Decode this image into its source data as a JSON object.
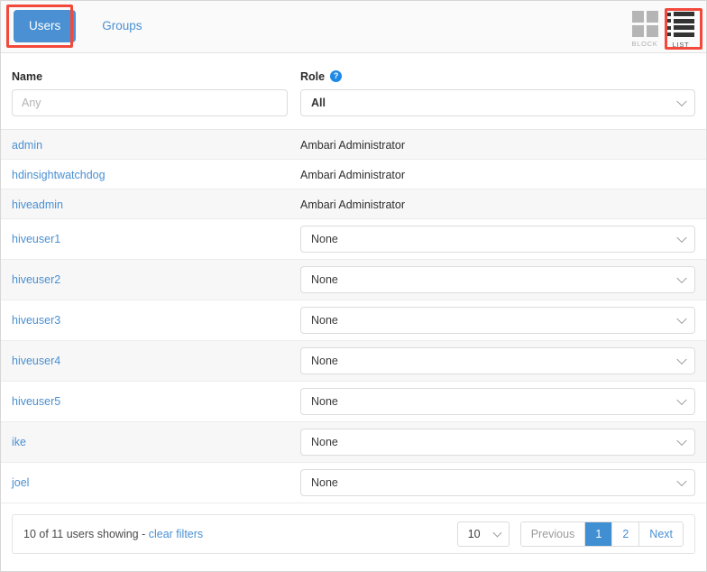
{
  "tabs": [
    {
      "label": "Users",
      "active": true
    },
    {
      "label": "Groups",
      "active": false
    }
  ],
  "view_toggle": {
    "block_label": "BLOCK",
    "list_label": "LIST",
    "selected": "LIST",
    "block_icon": "grid-icon",
    "list_icon": "list-icon"
  },
  "filters": {
    "name_label": "Name",
    "name_placeholder": "Any",
    "name_value": "",
    "role_label": "Role",
    "role_help_icon": "help-circle-icon",
    "role_value": "All"
  },
  "table": {
    "columns": [
      "Name",
      "Role"
    ],
    "rows": [
      {
        "name": "admin",
        "role_type": "text",
        "role": "Ambari Administrator"
      },
      {
        "name": "hdinsightwatchdog",
        "role_type": "text",
        "role": "Ambari Administrator"
      },
      {
        "name": "hiveadmin",
        "role_type": "text",
        "role": "Ambari Administrator"
      },
      {
        "name": "hiveuser1",
        "role_type": "select",
        "role": "None"
      },
      {
        "name": "hiveuser2",
        "role_type": "select",
        "role": "None"
      },
      {
        "name": "hiveuser3",
        "role_type": "select",
        "role": "None"
      },
      {
        "name": "hiveuser4",
        "role_type": "select",
        "role": "None"
      },
      {
        "name": "hiveuser5",
        "role_type": "select",
        "role": "None"
      },
      {
        "name": "ike",
        "role_type": "select",
        "role": "None"
      },
      {
        "name": "joel",
        "role_type": "select",
        "role": "None"
      }
    ]
  },
  "footer": {
    "status_text": "10 of 11 users showing - ",
    "clear_filters_label": "clear filters",
    "page_size": "10",
    "pagination": [
      {
        "label": "Previous",
        "state": "disabled"
      },
      {
        "label": "1",
        "state": "active"
      },
      {
        "label": "2",
        "state": "normal"
      },
      {
        "label": "Next",
        "state": "normal"
      }
    ]
  },
  "annotations": {
    "users_tab_highlight": "red-box",
    "list_toggle_highlight": "red-box",
    "highlight_color": "#f2493c"
  }
}
